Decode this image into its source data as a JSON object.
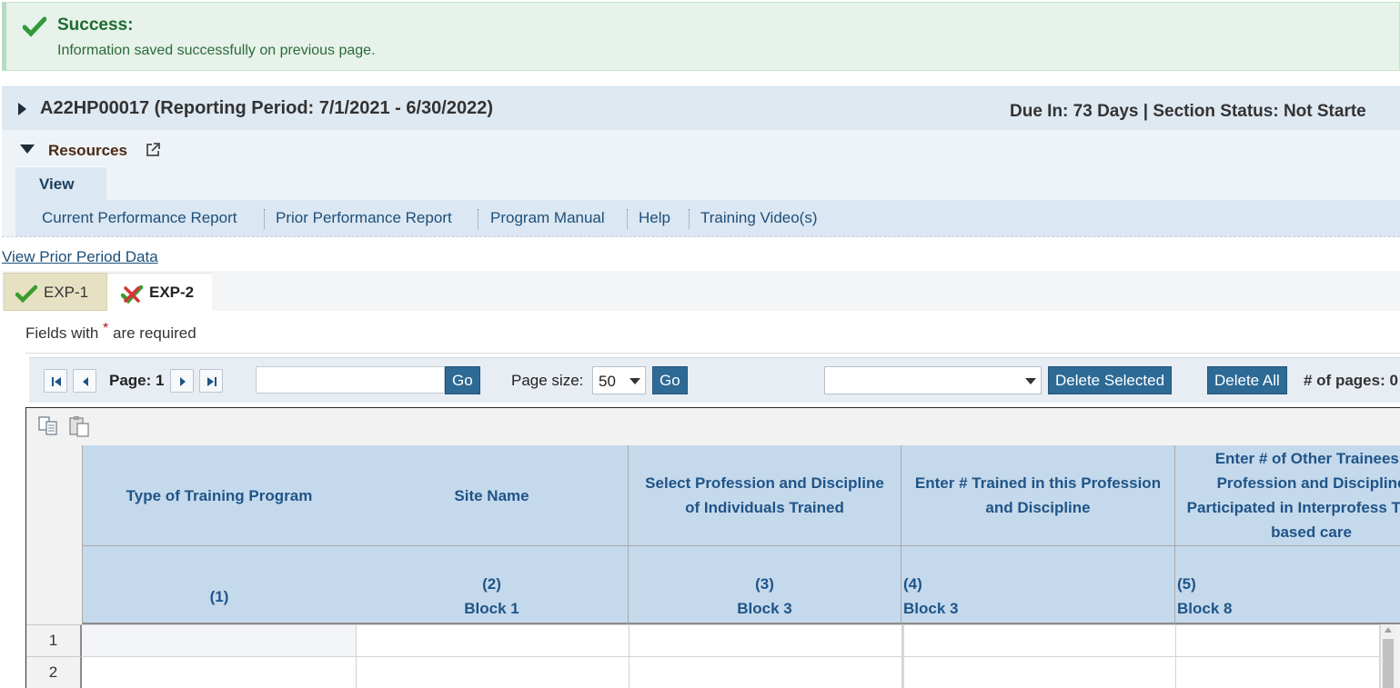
{
  "success": {
    "title": "Success:",
    "message": "Information saved successfully on previous page."
  },
  "header": {
    "grant": "A22HP00017 (Reporting Period: 7/1/2021 - 6/30/2022)",
    "status": "Due In: 73 Days | Section Status: Not Starte"
  },
  "resources": {
    "label": "Resources",
    "view_tab": "View",
    "links": [
      "Current Performance Report",
      "Prior Performance Report",
      "Program Manual",
      "Help",
      "Training Video(s)"
    ]
  },
  "prior_link": "View Prior Period Data",
  "tabs": [
    {
      "label": "EXP-1",
      "status": "complete"
    },
    {
      "label": "EXP-2",
      "status": "incomplete"
    }
  ],
  "required_note": {
    "before": "Fields with",
    "star": "*",
    "after": "are required"
  },
  "pager": {
    "page_label": "Page: 1",
    "go_label": "Go",
    "page_size_label": "Page size:",
    "page_size_value": "50",
    "go2_label": "Go",
    "delete_selected": "Delete Selected",
    "delete_all": "Delete All",
    "num_pages_label": "# of pages: 0"
  },
  "grid": {
    "headers": [
      "Type of Training Program",
      "Site Name",
      "Select Profession and Discipline of Individuals Trained",
      "Enter # Trained in this Profession and Discipline",
      "Enter # of Other Trainees i Profession and Discipline Participated in Interprofess Team-based care"
    ],
    "subheaders": [
      {
        "num": "(1)",
        "block": ""
      },
      {
        "num": "(2)",
        "block": "Block 1"
      },
      {
        "num": "(3)",
        "block": "Block 3"
      },
      {
        "num": "(4)",
        "block": "Block 3"
      },
      {
        "num": "(5)",
        "block": "Block 8"
      }
    ],
    "rows": [
      "1",
      "2"
    ]
  },
  "colors": {
    "success_bg": "#e6f2ea",
    "header_bg": "#dfe9f2",
    "grid_header_bg": "#c5d9ec",
    "button_bg": "#2d6a96"
  }
}
